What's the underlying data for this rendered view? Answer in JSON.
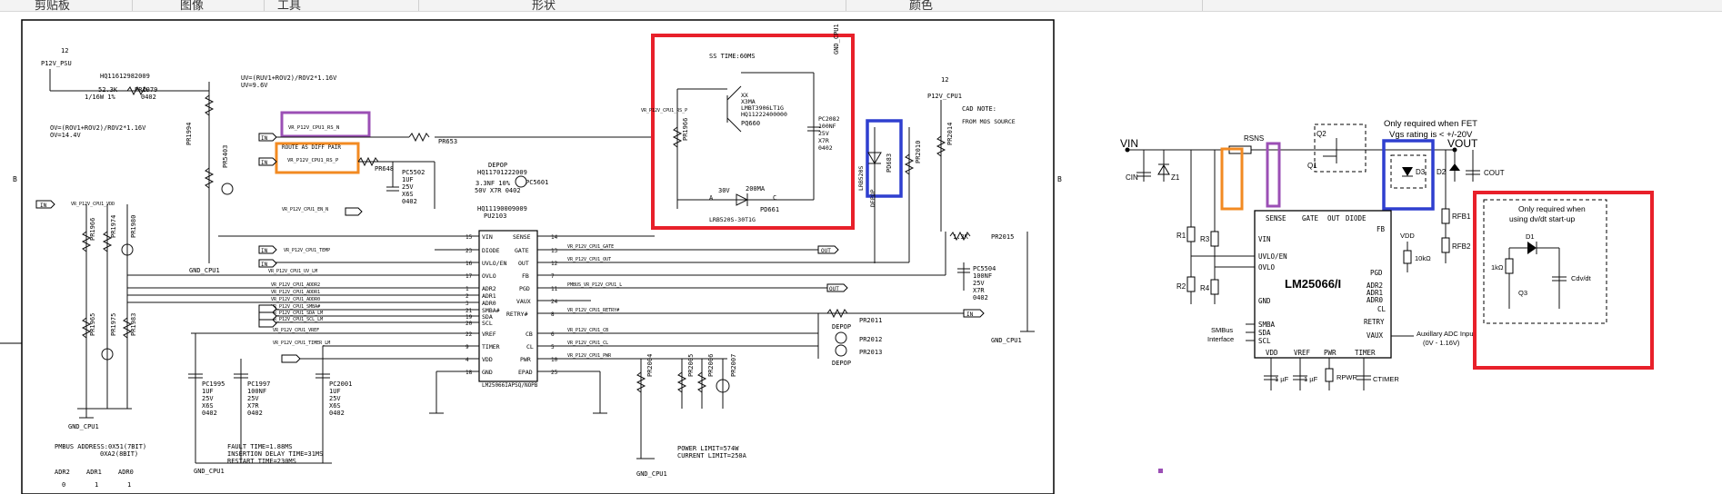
{
  "ribbon": {
    "groups": [
      "剪贴板",
      "图像",
      "工具",
      "形状",
      "颜色"
    ]
  },
  "left_schematic": {
    "connector_num_top": "12",
    "psu_label": "P12V_PSU",
    "r1979": {
      "part": "HQ11612982009",
      "ref": "PR1979",
      "val": "52.3K",
      "spec": "1/16W  1%",
      "pkg": "0402"
    },
    "uv_note": "UV=(RUV1+ROV2)/ROV2*1.16V",
    "uv_value": "UV=9.6V",
    "ov_note": "OV=(ROV1+ROV2)/ROV2*1.16V",
    "ov_value": "OV=14.4V",
    "net_sense_n": "VR_P12V_CPU1_RS_N",
    "net_sense_p": "VR_P12V_CPU1_RS_P",
    "note_route": "ROUTE AS DIFF PAIR",
    "ss_time": "SS TIME:60MS",
    "gnd_cpu1_tr": "GND_CPU1",
    "q_lines": [
      "XX",
      "X3MA",
      "LMBT3906LT1G",
      "HQ11222400000"
    ],
    "pq660": "PQ660",
    "pc2082": [
      "PC2082",
      "100NF",
      "25V",
      "X7R",
      "0402"
    ],
    "pd661": "PD661",
    "pd661_part": "LRB520S-30T1G",
    "v30": "30V",
    "ma200": "200MA",
    "anode": "A",
    "cathode": "C",
    "pd683": "PD683",
    "lrb": "LRB520S",
    "pr2010": "PR2010",
    "pr2014": "PR2014",
    "p12v_cpu1": "P12V_CPU1",
    "cad_note": [
      "CAD NOTE:",
      "FROM MOS SOURCE"
    ],
    "pr653": "PR653",
    "pr648": "PR648",
    "pc5502": [
      "PC5502",
      "1UF",
      "25V",
      "X6S",
      "0402"
    ],
    "depop_label": "DEPOP",
    "pc5601_part": "HQ11701222009",
    "pc5601": "PC5601",
    "pc5601_spec": "3.3NF  10%",
    "pc5601_spec2": "50V  X7R  0402",
    "pu2103_part": "HQ11190009009",
    "pu2103": "PU2103",
    "ic_name": "LM25066IAPSQ/NOPB",
    "pins_left": [
      {
        "n": "15",
        "name": "VIN"
      },
      {
        "n": "23",
        "name": "DIODE"
      },
      {
        "n": "16",
        "name": "UVLO/EN"
      },
      {
        "n": "17",
        "name": "OVLO"
      },
      {
        "n": "1",
        "name": "ADR2"
      },
      {
        "n": "2",
        "name": "ADR1"
      },
      {
        "n": "3",
        "name": "ADR0"
      },
      {
        "n": "21",
        "name": "SMBA#"
      },
      {
        "n": "19",
        "name": "SDA"
      },
      {
        "n": "20",
        "name": "SCL"
      },
      {
        "n": "22",
        "name": "VREF"
      },
      {
        "n": "9",
        "name": "TIMER"
      },
      {
        "n": "4",
        "name": "VDD"
      },
      {
        "n": "18",
        "name": "GND"
      }
    ],
    "pins_right": [
      {
        "n": "14",
        "name": "SENSE"
      },
      {
        "n": "13",
        "name": "GATE"
      },
      {
        "n": "12",
        "name": "OUT"
      },
      {
        "n": "7",
        "name": "FB"
      },
      {
        "n": "11",
        "name": "PGD"
      },
      {
        "n": "24",
        "name": "VAUX"
      },
      {
        "n": "8",
        "name": "RETRY#"
      },
      {
        "n": "6",
        "name": "CB"
      },
      {
        "n": "5",
        "name": "CL"
      },
      {
        "n": "10",
        "name": "PWR"
      },
      {
        "n": "25",
        "name": "EPAD"
      }
    ],
    "nets_left": [
      "VR_P12V_CPU1_VDD",
      "VR_P12V_CPU1_EN_N",
      "VR_P12V_CPU1_TEMP",
      "VR_P12V_CPU1_UV_LM",
      "VR_P12V_CPU1_ADDR2",
      "VR_P12V_CPU1_ADDR1",
      "VR_P12V_CPU1_ADDR0",
      "VR_P12V_CPU1_SMBA#",
      "VR_P12V_CPU1_SDA_LM",
      "VR_P12V_CPU1_SCL_LM",
      "VR_P12V_CPU1_VREF",
      "VR_P12V_CPU1_TIMER_LM"
    ],
    "nets_right": [
      "VR_P12V_CPU1_GATE",
      "VR_P12V_CPU1_OUT",
      "PMBUS_VR_P12V_CPU1_L",
      "VR_P12V_CPU1_RETRY#",
      "VR_P12V_CPU1_CB",
      "VR_P12V_CPU1_CL",
      "VR_P12V_CPU1_PWR"
    ],
    "pr2015": "PR2015",
    "pr2015_val": "1.3K",
    "pc5504": [
      "PC5504",
      "100NF",
      "25V",
      "X7R",
      "0402"
    ],
    "pr2011": "PR2011",
    "pr2012": "PR2012",
    "pr2013": "PR2013",
    "gnd": "GND_CPU1",
    "refs_left_col": [
      "PR1966",
      "PR1974",
      "PR1980",
      "PR1965",
      "PR1975",
      "PR1983",
      "PR1994",
      "PR5403"
    ],
    "pc1995": [
      "PC1995",
      "1UF",
      "25V",
      "X6S",
      "0402"
    ],
    "pc1997": [
      "PC1997",
      "100NF",
      "25V",
      "X7R",
      "0402"
    ],
    "pc2001": [
      "PC2001",
      "1UF",
      "25V",
      "X6S",
      "0402"
    ],
    "pr2004": "PR2004",
    "pr2005": "PR2005",
    "pr2006": "PR2006",
    "pr2007": "PR2007",
    "fault_notes": [
      "FAULT TIME=1.88MS",
      "INSERTION DELAY TIME=31MS",
      "RESTART TIME=230MS"
    ],
    "power_notes": [
      "POWER LIMIT=574W",
      "CURRENT LIMIT=250A"
    ],
    "pmbus_addr": [
      "PMBUS ADDRESS:0X51(7BIT)",
      "0XA2(8BIT)"
    ],
    "addr_table": {
      "headers": [
        "ADR2",
        "ADR1",
        "ADR0"
      ],
      "values": [
        "0",
        "1",
        "1"
      ]
    },
    "border_b": "B"
  },
  "right_schematic": {
    "vin": "VIN",
    "vout": "VOUT",
    "rsns": "RSNS",
    "q1": "Q1",
    "q2": "Q2",
    "d3": "D3",
    "d2": "D2",
    "cout": "COUT",
    "cin": "CIN",
    "z1": "Z1",
    "r1": "R1",
    "r2": "R2",
    "r3": "R3",
    "r4": "R4",
    "rfb1": "RFB1",
    "rfb2": "RFB2",
    "note_fet": [
      "Only required when FET",
      "Vgs rating is < +/-20V"
    ],
    "ic_name": "LM25066/I",
    "pin_left": [
      "VIN",
      "UVLO/EN",
      "OVLO",
      "GND",
      "SMBA",
      "SDA",
      "SCL"
    ],
    "pin_top": [
      "SENSE",
      "GATE",
      "OUT",
      "DIODE"
    ],
    "pin_right": [
      "FB",
      "PGD",
      "ADR2",
      "ADR1",
      "ADR0",
      "CL",
      "RETRY",
      "VAUX"
    ],
    "pin_bottom": [
      "VDD",
      "VREF",
      "PWR",
      "TIMER"
    ],
    "smbus": [
      "SMBus",
      "Interface"
    ],
    "vdd_r": "10kΩ",
    "vdd_label": "VDD",
    "aux_note": [
      "Auxillary ADC Input",
      "(0V - 1.16V)"
    ],
    "cap1": "1 µF",
    "cap2": "1 µF",
    "rpwr": "RPWR",
    "ctimer": "CTIMER",
    "dvdt_note": [
      "Only required when",
      "using dv/dt start-up"
    ],
    "d1": "D1",
    "q3": "Q3",
    "r1k": "1kΩ",
    "cdvdt": "Cdv/dt"
  },
  "colors": {
    "red": "#e8202a",
    "orange": "#f28a22",
    "purple": "#9b4fb5",
    "blue": "#2f3fcf"
  }
}
